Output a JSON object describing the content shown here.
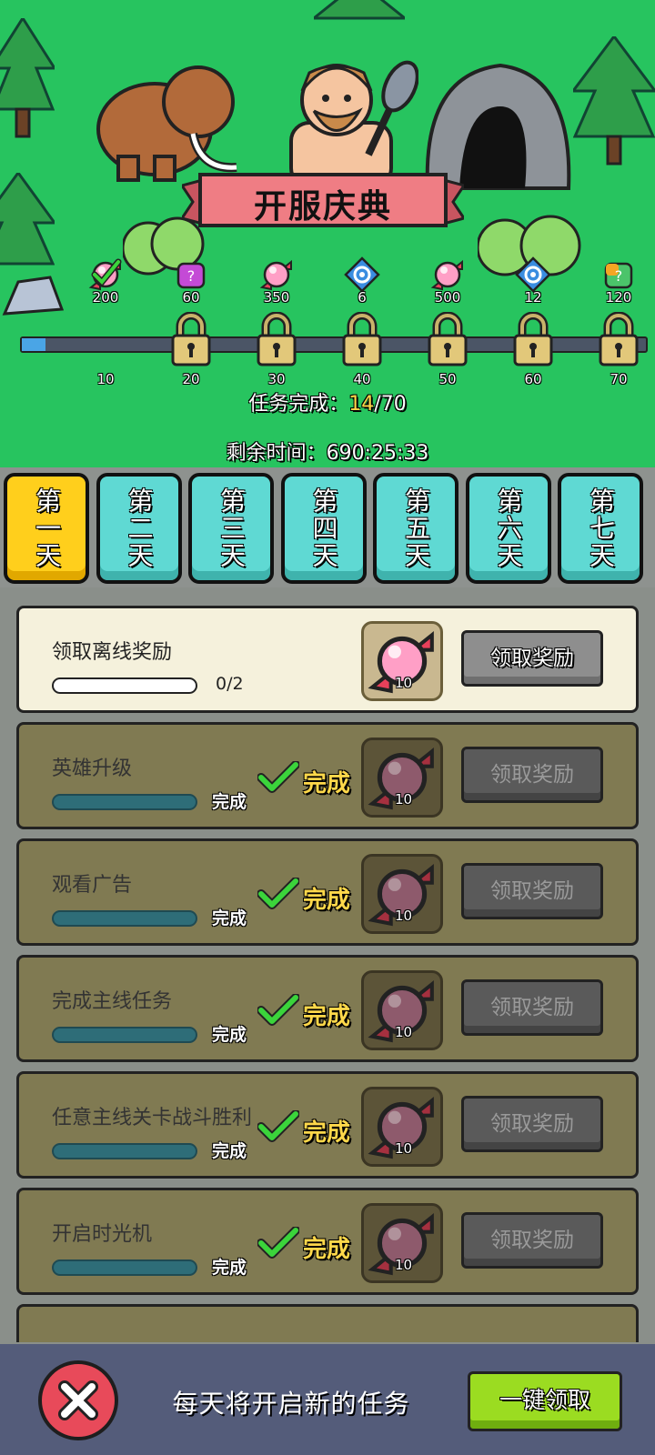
{
  "banner_title": "开服庆典",
  "milestones": [
    {
      "icon": "pink-candy-checked-icon",
      "reward": "200",
      "tick": "10"
    },
    {
      "icon": "purple-mystery-box-icon",
      "reward": "60",
      "tick": "20"
    },
    {
      "icon": "pink-candy-icon",
      "reward": "350",
      "tick": "30"
    },
    {
      "icon": "blue-swirl-gem-icon",
      "reward": "6",
      "tick": "40"
    },
    {
      "icon": "pink-candy-icon",
      "reward": "500",
      "tick": "50"
    },
    {
      "icon": "blue-swirl-gem-icon",
      "reward": "12",
      "tick": "60"
    },
    {
      "icon": "rainbow-mystery-box-icon",
      "reward": "120",
      "tick": "70"
    }
  ],
  "progress": {
    "done": 14,
    "total": 70
  },
  "status": {
    "tasks_label": "任务完成：",
    "tasks_done": "14",
    "tasks_total": "/70",
    "time_label": "剩余时间：",
    "time_value": "690:25:33"
  },
  "tabs": [
    {
      "label": "第一天",
      "active": true
    },
    {
      "label": "第二天",
      "active": false
    },
    {
      "label": "第三天",
      "active": false
    },
    {
      "label": "第四天",
      "active": false
    },
    {
      "label": "第五天",
      "active": false
    },
    {
      "label": "第六天",
      "active": false
    },
    {
      "label": "第七天",
      "active": false
    }
  ],
  "tasks": [
    {
      "name": "领取离线奖励",
      "progress_text": "0/2",
      "done": false,
      "reward_qty": "10",
      "claim_label": "领取奖励"
    },
    {
      "name": "英雄升级",
      "done": true,
      "done_small": "完成",
      "done_big": "完成",
      "reward_qty": "10",
      "claim_label": "领取奖励"
    },
    {
      "name": "观看广告",
      "done": true,
      "done_small": "完成",
      "done_big": "完成",
      "reward_qty": "10",
      "claim_label": "领取奖励"
    },
    {
      "name": "完成主线任务",
      "done": true,
      "done_small": "完成",
      "done_big": "完成",
      "reward_qty": "10",
      "claim_label": "领取奖励"
    },
    {
      "name": "任意主线关卡战斗胜利",
      "done": true,
      "done_small": "完成",
      "done_big": "完成",
      "reward_qty": "10",
      "claim_label": "领取奖励"
    },
    {
      "name": "开启时光机",
      "done": true,
      "done_small": "完成",
      "done_big": "完成",
      "reward_qty": "10",
      "claim_label": "领取奖励"
    }
  ],
  "bottom": {
    "message": "每天将开启新的任务",
    "claim_all_label": "一键领取"
  }
}
